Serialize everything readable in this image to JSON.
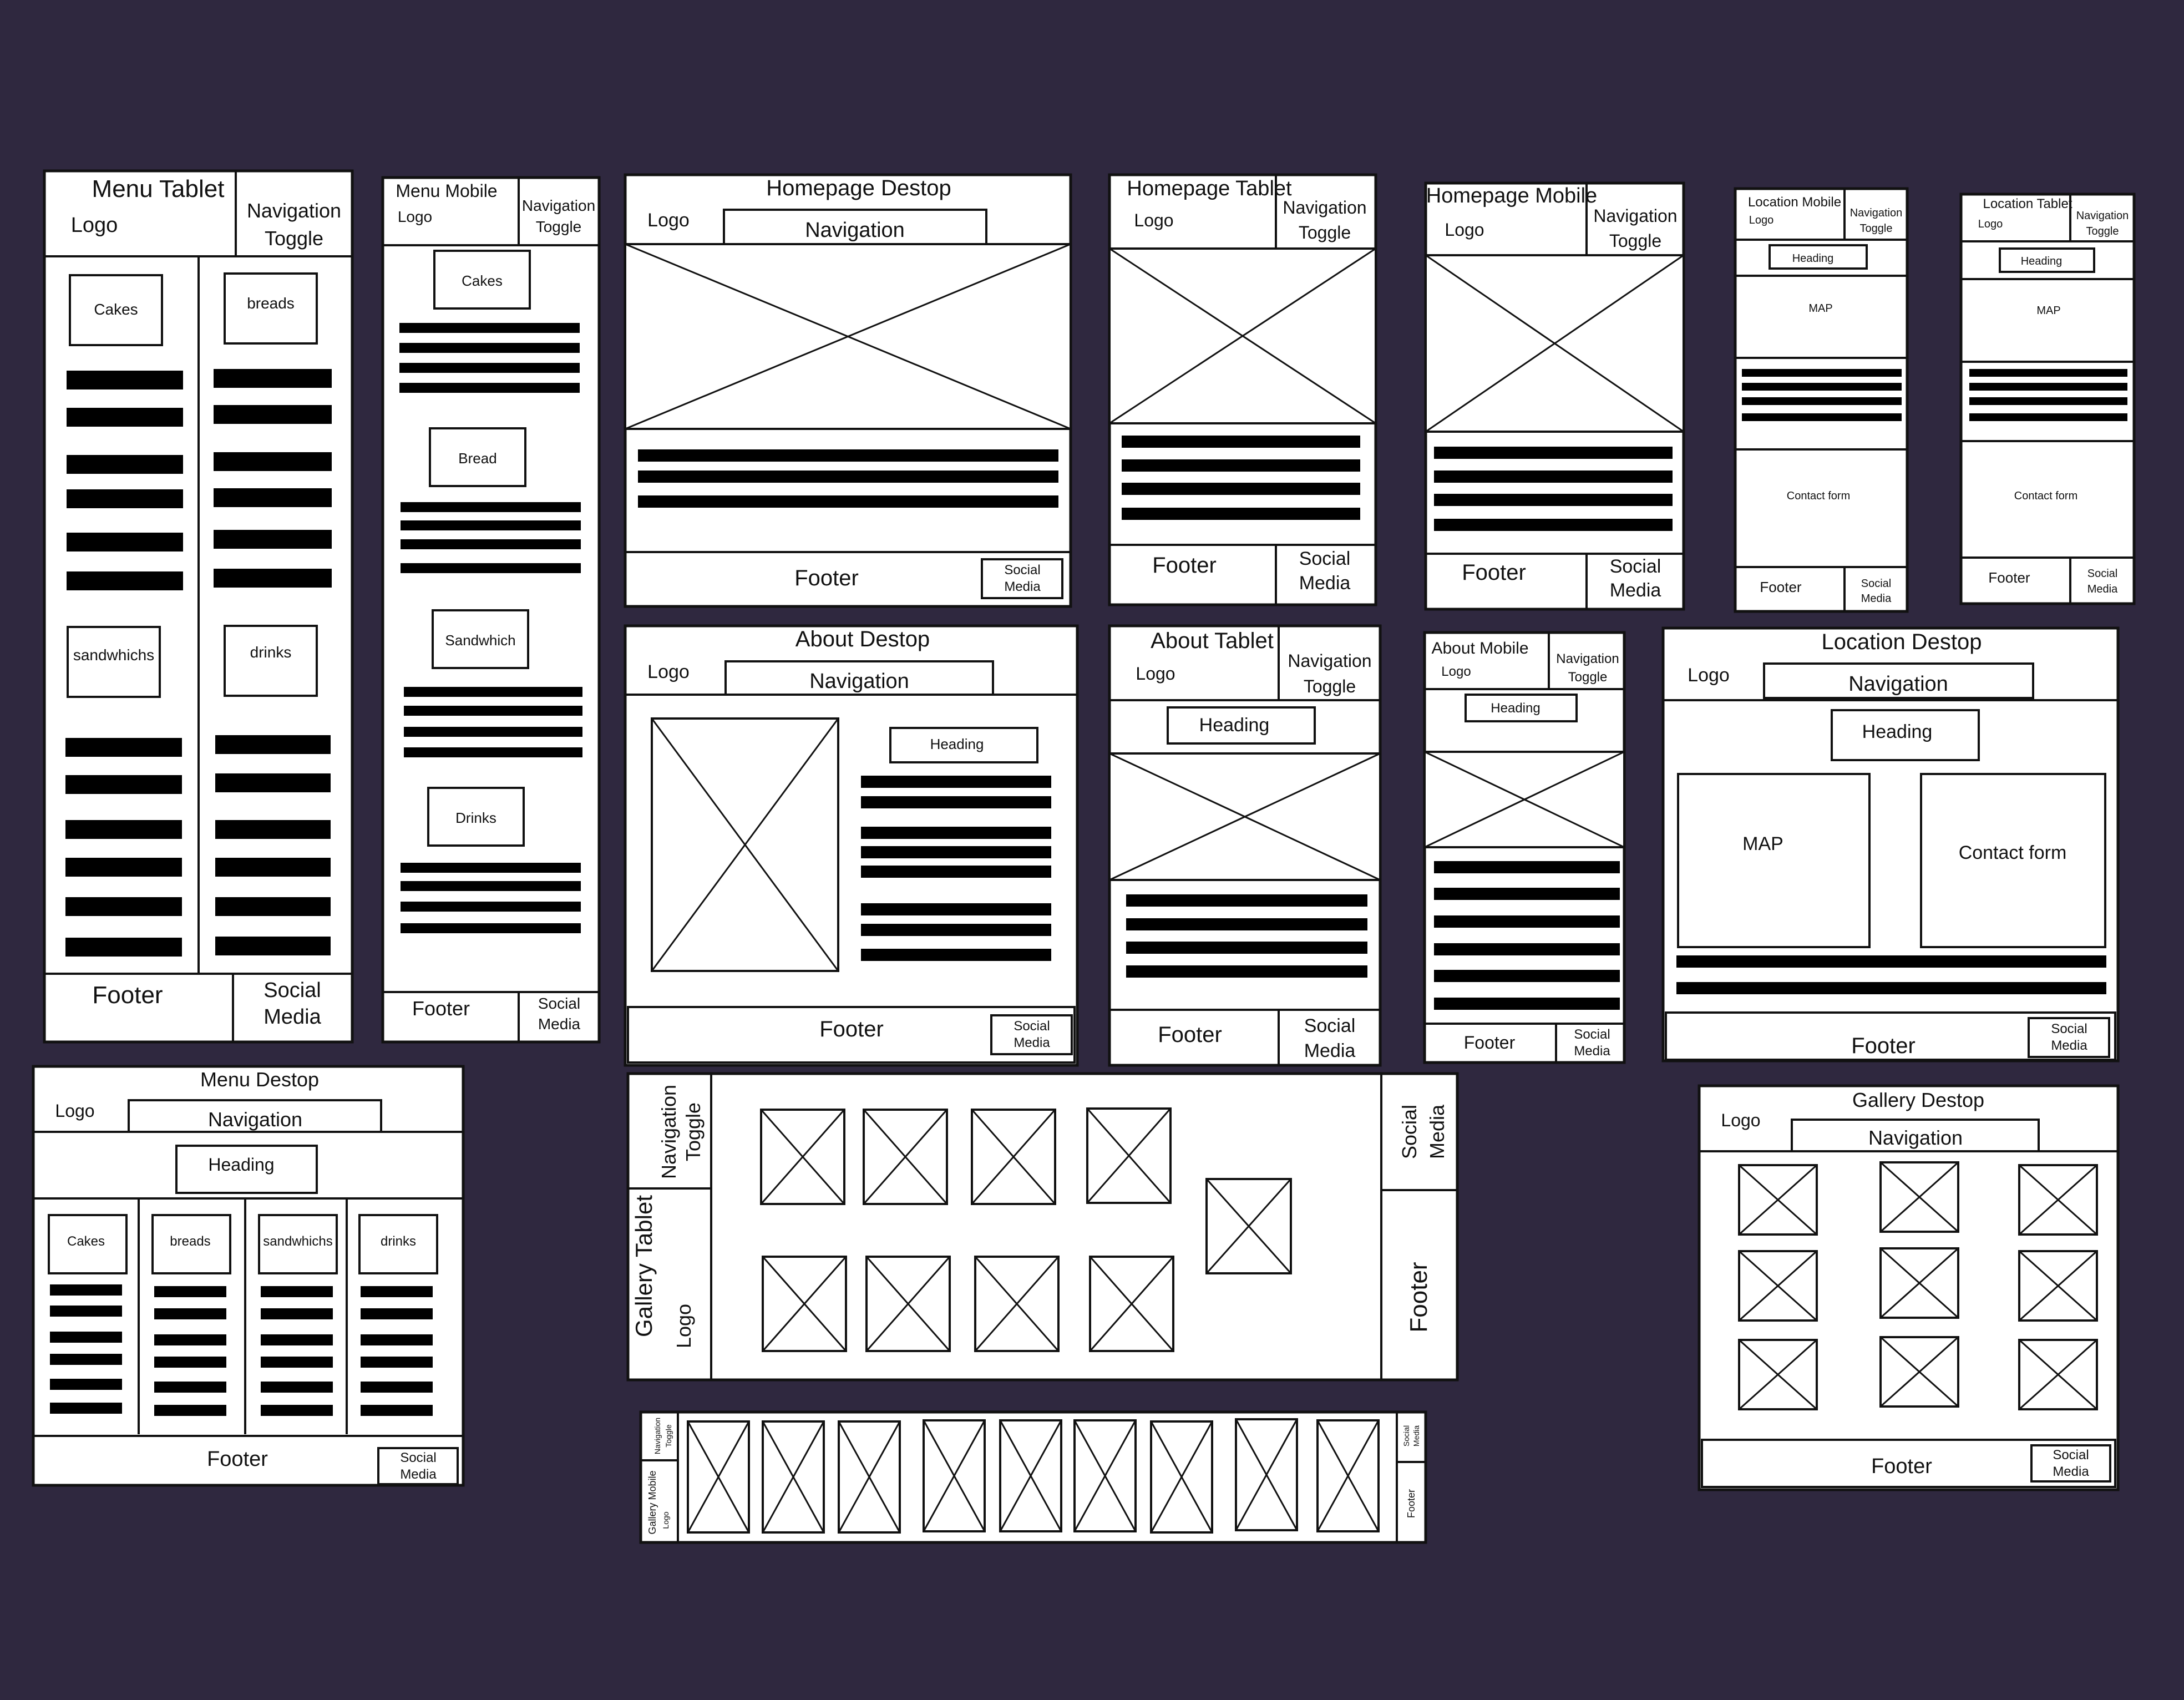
{
  "colors": {
    "background": "#2f283f",
    "paper": "#ffffff",
    "ink": "#111111"
  },
  "common": {
    "logo": "Logo",
    "navigation": "Navigation",
    "nav_toggle_1": "Navigation",
    "nav_toggle_2": "Toggle",
    "footer": "Footer",
    "social_1": "Social",
    "social_2": "Media",
    "heading": "Heading",
    "map": "MAP",
    "contact": "Contact form"
  },
  "menu_tablet": {
    "title": "Menu Tablet",
    "cakes": "Cakes",
    "breads": "breads",
    "sandwiches": "sandwhichs",
    "drinks": "drinks"
  },
  "menu_mobile": {
    "title": "Menu Mobile",
    "cakes": "Cakes",
    "bread": "Bread",
    "sandwich": "Sandwhich",
    "drinks": "Drinks"
  },
  "homepage_desktop": {
    "title": "Homepage Destop"
  },
  "homepage_tablet": {
    "title": "Homepage Tablet"
  },
  "homepage_mobile": {
    "title": "Homepage Mobile"
  },
  "location_mobile": {
    "title": "Location Mobile"
  },
  "location_tablet": {
    "title": "Location Tablet"
  },
  "about_desktop": {
    "title": "About Destop"
  },
  "about_tablet": {
    "title": "About Tablet"
  },
  "about_mobile": {
    "title": "About Mobile"
  },
  "location_desktop": {
    "title": "Location Destop"
  },
  "menu_desktop": {
    "title": "Menu Destop",
    "cakes": "Cakes",
    "breads": "breads",
    "sandwiches": "sandwhichs",
    "drinks": "drinks"
  },
  "gallery_tablet": {
    "title": "Gallery Tablet"
  },
  "gallery_mobile": {
    "title": "Gallery Mobile"
  },
  "gallery_desktop": {
    "title": "Gallery Destop"
  }
}
